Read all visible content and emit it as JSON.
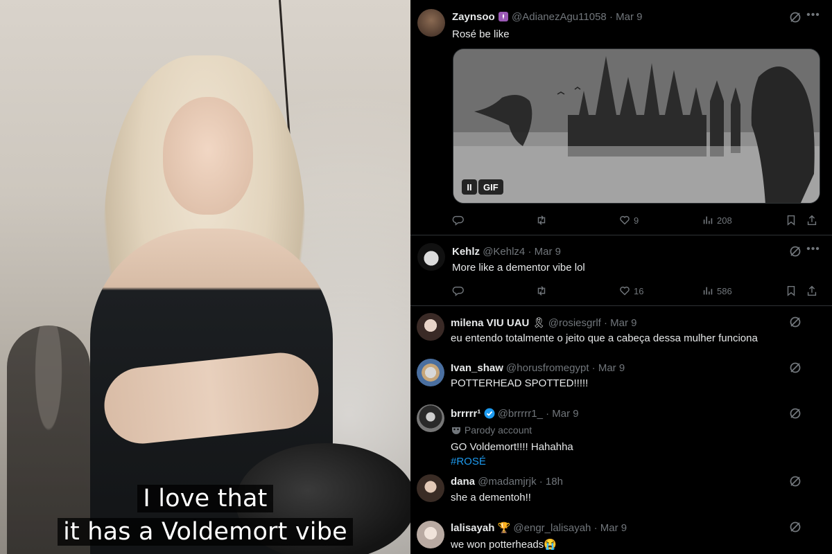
{
  "video": {
    "subtitle_line1": "I love that",
    "subtitle_line2": "it has a Voldemort vibe"
  },
  "colors": {
    "background": "#000000",
    "text_primary": "#e7e9ea",
    "text_secondary": "#71767b",
    "link": "#1d9bf0",
    "divider": "#2f3336"
  },
  "tweets": [
    {
      "name": "Zaynsoo",
      "handle": "@AdianezAgu11058",
      "date": "· Mar 9",
      "text": "Rosé be like",
      "media": {
        "type": "gif",
        "badge": "GIF",
        "pause_label": "II"
      },
      "likes": "9",
      "views": "208",
      "icons": [
        "grok-icon",
        "more-icon",
        "reply-icon",
        "retweet-icon",
        "like-icon",
        "views-icon",
        "bookmark-icon",
        "share-icon"
      ]
    },
    {
      "name": "Kehlz",
      "handle": "@Kehlz4",
      "date": "· Mar 9",
      "text": "More like a dementor vibe lol",
      "likes": "16",
      "views": "586"
    },
    {
      "name": "milena VIU UAU",
      "name_emoji": "🎗",
      "handle": "@rosiesgrlf",
      "date": "· Mar 9",
      "text": "eu entendo totalmente o jeito que a cabeça dessa mulher funciona"
    },
    {
      "name": "Ivan_shaw",
      "handle": "@horusfromegypt",
      "date": "· Mar 9",
      "text": "POTTERHEAD SPOTTED!!!!!"
    },
    {
      "name": "brrrrr",
      "name_suffix": "¹",
      "handle": "@brrrrr1_",
      "date": "· Mar 9",
      "label": "Parody account",
      "text": "GO Voldemort!!!! Hahahha",
      "hashtag": "#ROSÉ"
    },
    {
      "name": "dana",
      "handle": "@madamjrjk",
      "date": "· 18h",
      "text": "she a dementoh!!"
    },
    {
      "name": "lalisayah",
      "name_emoji": "🏆",
      "handle": "@engr_lalisayah",
      "date": "· Mar 9",
      "text": "we won potterheads",
      "text_emoji": "😭"
    }
  ]
}
